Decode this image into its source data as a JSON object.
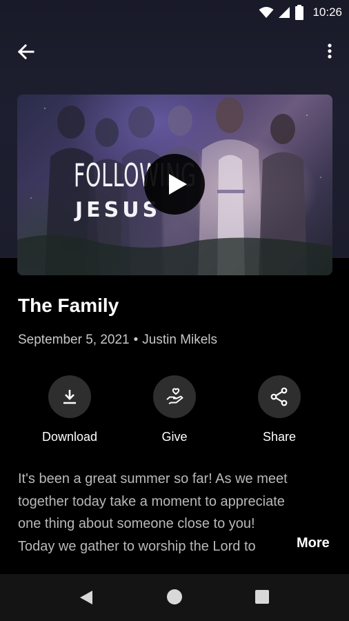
{
  "status_bar": {
    "time": "10:26",
    "icons": [
      "wifi-icon",
      "cellular-signal-icon",
      "battery-icon"
    ]
  },
  "app_bar": {
    "back_icon": "arrow-left-icon",
    "menu_icon": "more-vertical-icon"
  },
  "hero": {
    "title_line_1": "FOLLOWING",
    "title_line_2": "JESUS",
    "play_icon": "play-icon"
  },
  "sermon": {
    "title": "The Family",
    "date": "September 5, 2021",
    "separator": "•",
    "speaker": "Justin Mikels"
  },
  "actions": [
    {
      "label": "Download",
      "icon": "download-icon"
    },
    {
      "label": "Give",
      "icon": "give-heart-hand-icon"
    },
    {
      "label": "Share",
      "icon": "share-icon"
    }
  ],
  "description": {
    "lines": [
      "It's been a great summer so far! As we meet",
      "together today take a moment to appreciate",
      "one thing about someone close to you!",
      "Today we gather to worship the Lord to"
    ],
    "more_label": "More"
  },
  "nav_bar": {
    "icons": [
      "nav-back-icon",
      "nav-home-icon",
      "nav-recents-icon"
    ]
  },
  "colors": {
    "background": "#000000",
    "header_background": "#1d1f30",
    "action_circle": "#2e2e2e",
    "meta_text": "#c8c8c8",
    "description_text": "#b9b9b9"
  }
}
